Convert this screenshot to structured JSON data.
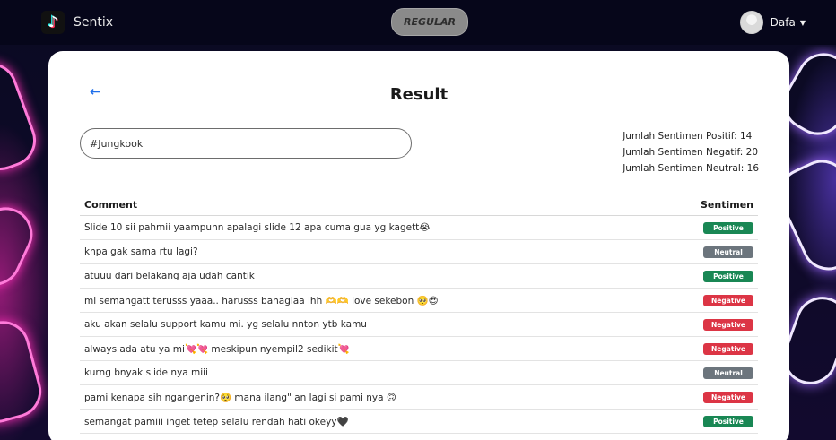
{
  "navbar": {
    "brand_name": "Sentix",
    "mode_button": "REGULAR",
    "user_name": "Dafa"
  },
  "page": {
    "title": "Result",
    "search_value": "#Jungkook",
    "stats": {
      "positive": "Jumlah Sentimen Positif: 14",
      "negative": "Jumlah Sentimen Negatif: 20",
      "neutral": "Jumlah Sentimen Neutral: 16"
    }
  },
  "table": {
    "headers": {
      "comment": "Comment",
      "sentiment": "Sentimen"
    },
    "rows": [
      {
        "comment": "Slide 10 sii pahmii yaampunn apalagi slide 12 apa cuma gua yg kagett😭",
        "sentiment": "Positive"
      },
      {
        "comment": "knpa gak sama rtu lagi?",
        "sentiment": "Neutral"
      },
      {
        "comment": "atuuu dari belakang aja udah cantik",
        "sentiment": "Positive"
      },
      {
        "comment": "mi semangatt terusss yaaa.. harusss bahagiaa ihh 🫶🫶 love sekebon 🥺😍",
        "sentiment": "Negative"
      },
      {
        "comment": "aku akan selalu support kamu mi. yg selalu nnton ytb kamu",
        "sentiment": "Negative"
      },
      {
        "comment": "always ada atu ya mi💘💘 meskipun nyempil2 sedikit💘",
        "sentiment": "Negative"
      },
      {
        "comment": "kurng bnyak slide nya miii",
        "sentiment": "Neutral"
      },
      {
        "comment": "pami kenapa sih ngangenin?🥺 mana ilang\" an lagi si pami nya 🙃",
        "sentiment": "Negative"
      },
      {
        "comment": "semangat pamiii inget tetep selalu rendah hati okeyy🖤",
        "sentiment": "Positive"
      }
    ]
  }
}
